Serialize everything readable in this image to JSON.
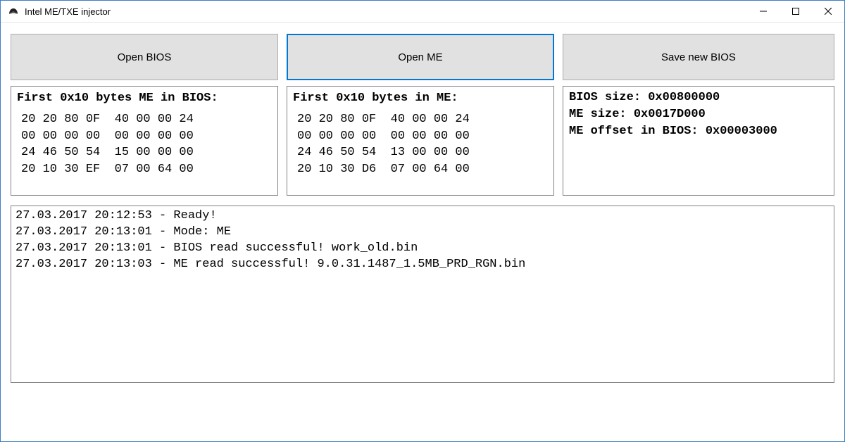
{
  "window": {
    "title": "Intel ME/TXE injector"
  },
  "buttons": {
    "open_bios": "Open BIOS",
    "open_me": "Open ME",
    "save_bios": "Save new BIOS"
  },
  "hex_bios": {
    "header": "First 0x10 bytes ME in BIOS:",
    "body": "20 20 80 0F  40 00 00 24\n00 00 00 00  00 00 00 00\n24 46 50 54  15 00 00 00\n20 10 30 EF  07 00 64 00"
  },
  "hex_me": {
    "header": "First 0x10 bytes in ME:",
    "body": "20 20 80 0F  40 00 00 24\n00 00 00 00  00 00 00 00\n24 46 50 54  13 00 00 00\n20 10 30 D6  07 00 64 00"
  },
  "info": {
    "body": "BIOS size: 0x00800000\nME size: 0x0017D000\nME offset in BIOS: 0x00003000"
  },
  "log": {
    "body": "27.03.2017 20:12:53 - Ready!\n27.03.2017 20:13:01 - Mode: ME\n27.03.2017 20:13:01 - BIOS read successful! work_old.bin\n27.03.2017 20:13:03 - ME read successful! 9.0.31.1487_1.5MB_PRD_RGN.bin"
  }
}
